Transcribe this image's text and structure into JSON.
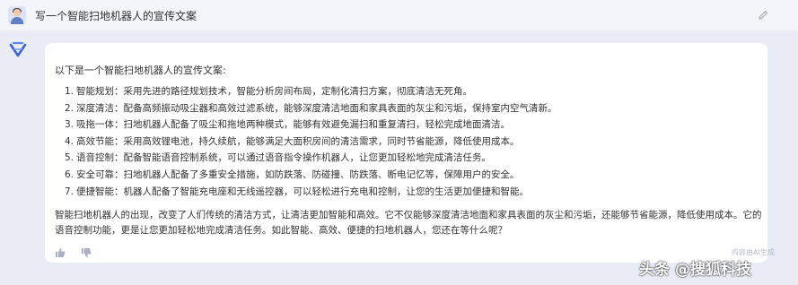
{
  "header": {
    "prompt_text": "写一个智能扫地机器人的宣传文案",
    "user_avatar_icon": "user-avatar-icon",
    "edit_icon": "pencil-icon"
  },
  "answer": {
    "bot_logo_icon": "assistant-logo-icon",
    "intro": "以下是一个智能扫地机器人的宣传文案:",
    "items": [
      {
        "num": "1.",
        "text": "智能规划：采用先进的路径规划技术，智能分析房间布局，定制化清扫方案，彻底清洁无死角。"
      },
      {
        "num": "2.",
        "text": "深度清洁：配备高频振动吸尘器和高效过滤系统，能够深度清洁地面和家具表面的灰尘和污垢，保持室内空气清新。"
      },
      {
        "num": "3.",
        "text": "吸拖一体：扫地机器人配备了吸尘和拖地两种模式，能够有效避免漏扫和重复清扫，轻松完成地面清洁。"
      },
      {
        "num": "4.",
        "text": "高效节能：采用高效锂电池，持久续航，能够满足大面积房间的清洁需求，同时节省能源，降低使用成本。"
      },
      {
        "num": "5.",
        "text": "语音控制：配备智能语音控制系统，可以通过语音指令操作机器人，让您更加轻松地完成清洁任务。"
      },
      {
        "num": "6.",
        "text": "安全可靠：扫地机器人配备了多重安全措施，如防跌落、防碰撞、防跌落、断电记忆等，保障用户的安全。"
      },
      {
        "num": "7.",
        "text": "便捷智能：机器人配备了智能充电座和无线遥控器，可以轻松进行充电和控制，让您的生活更加便捷和智能。"
      }
    ],
    "closing": "智能扫地机器人的出现，改变了人们传统的清洁方式，让清洁更加智能和高效。它不仅能够深度清洁地面和家具表面的灰尘和污垢，还能够节省能源，降低使用成本。它的语音控制功能，更是让您更加轻松地完成清洁任务。如此智能、高效、便捷的扫地机器人，您还在等什么呢？",
    "thumb_up_icon": "thumb-up-icon",
    "thumb_down_icon": "thumb-down-icon",
    "ai_note": "内容由AI生成"
  },
  "watermark": "头条 @搜狐科技",
  "colors": {
    "background": "#e9ecf5",
    "topbar": "#f4f5fa",
    "card": "#ffffff",
    "text": "#333333"
  }
}
